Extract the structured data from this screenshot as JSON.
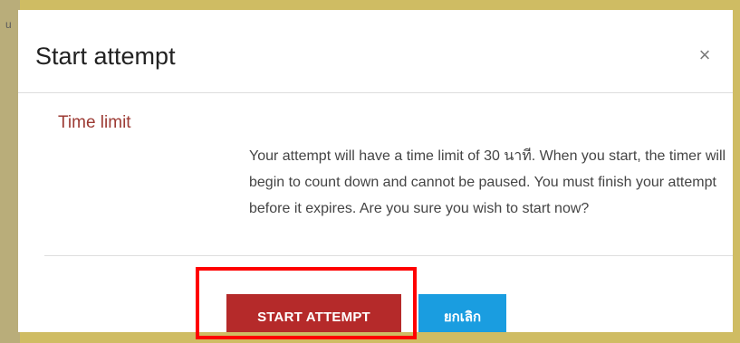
{
  "background": {
    "hint_text": "u",
    "accent_color": "#cfbc63"
  },
  "modal": {
    "title": "Start attempt",
    "close_icon": "close-icon",
    "close_symbol": "×",
    "time_limit": {
      "label": "Time limit",
      "text": "Your attempt will have a time limit of 30 นาที. When you start, the timer will begin to count down and cannot be paused. You must finish your attempt before it expires. Are you sure you wish to start now?"
    },
    "buttons": {
      "start_label": "START ATTEMPT",
      "cancel_label": "ยกเลิก"
    },
    "colors": {
      "label": "#9c3a33",
      "start_button": "#b52a2a",
      "cancel_button": "#1a9de0",
      "highlight": "#ff0000"
    }
  }
}
